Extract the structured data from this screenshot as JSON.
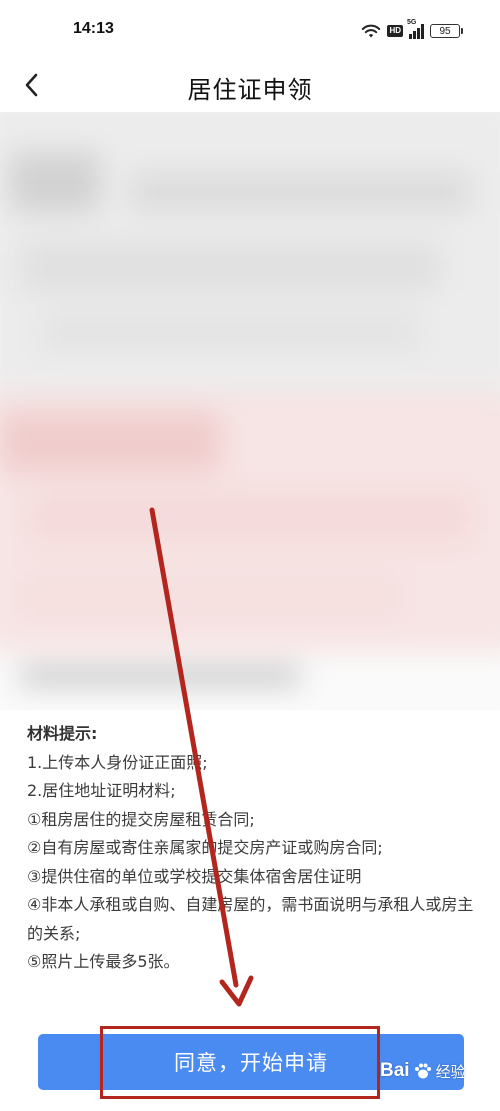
{
  "status_bar": {
    "time": "14:13",
    "network_label": "5G",
    "hd_label": "HD",
    "battery_level": "95"
  },
  "nav": {
    "title": "居住证申领",
    "back_icon": "chevron-left-icon"
  },
  "materials": {
    "heading": "材料提示:",
    "lines": [
      "1.上传本人身份证正面照;",
      "2.居住地址证明材料;",
      "①租房居住的提交房屋租赁合同;",
      "②自有房屋或寄住亲属家的提交房产证或购房合同;",
      "③提供住宿的单位或学校提交集体宿舍居住证明",
      "④非本人承租或自购、自建房屋的，需书面说明与承租人或房主的关系;",
      "⑤照片上传最多5张。"
    ]
  },
  "apply_button": {
    "label": "同意，开始申请",
    "color": "#4a8bf2"
  },
  "annotation": {
    "color": "#b3261e"
  },
  "watermark": {
    "brand": "Bai",
    "brand_suffix": "经验",
    "icon": "paw-icon"
  }
}
